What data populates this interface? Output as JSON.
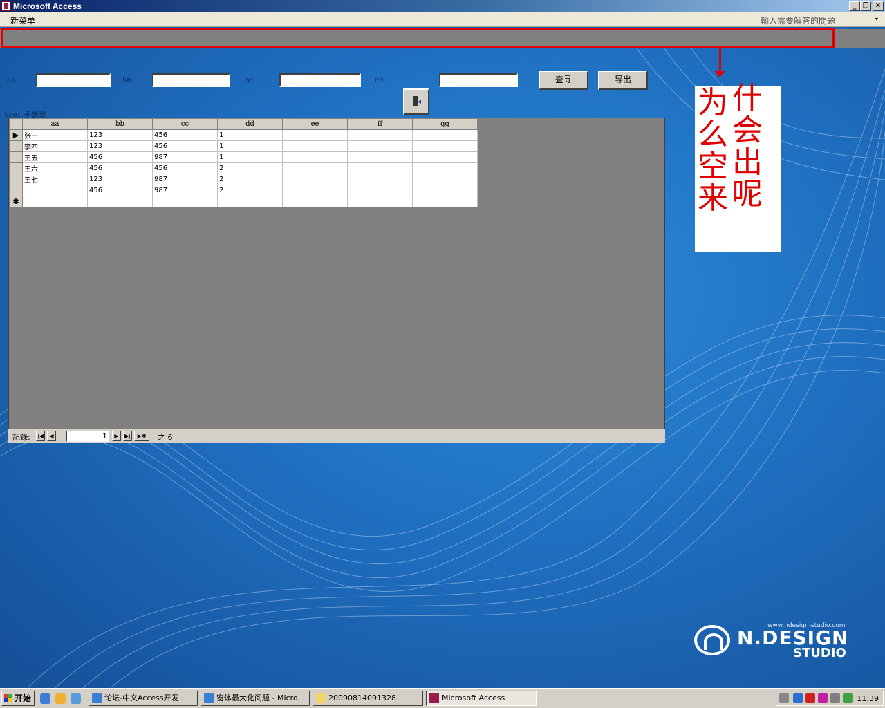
{
  "window": {
    "title": "Microsoft Access"
  },
  "window_buttons": {
    "minimize": "_",
    "restore": "❐",
    "close": "✕"
  },
  "menubar": {
    "menu_item": "新菜单",
    "help_placeholder": "輸入需要解答的問題",
    "help_arrow": "▾"
  },
  "filters": {
    "aa_label": "aa:",
    "bb_label": "bb:",
    "cc_label": "cc:",
    "dd_label": "dd",
    "aa_value": "",
    "bb_value": "",
    "cc_value": "",
    "dd_value": ""
  },
  "buttons": {
    "search": "查寻",
    "export": "导出"
  },
  "annotation": {
    "col1": "为么空来",
    "col2": "什会出呢"
  },
  "subform": {
    "label_en": "user",
    "label_zh": " 子表單"
  },
  "table": {
    "columns": [
      "aa",
      "bb",
      "cc",
      "dd",
      "ee",
      "ff",
      "gg"
    ],
    "rows": [
      [
        "张三",
        "123",
        "456",
        "1",
        "",
        "",
        ""
      ],
      [
        "李四",
        "123",
        "456",
        "1",
        "",
        "",
        ""
      ],
      [
        "王五",
        "456",
        "987",
        "1",
        "",
        "",
        ""
      ],
      [
        "王六",
        "456",
        "456",
        "2",
        "",
        "",
        ""
      ],
      [
        "王七",
        "123",
        "987",
        "2",
        "",
        "",
        ""
      ],
      [
        "",
        "456",
        "987",
        "2",
        "",
        "",
        ""
      ]
    ],
    "current_row_marker": "▶",
    "new_row_marker": "✱"
  },
  "navigation": {
    "label": "記錄:",
    "first": "|◀",
    "prev": "◀",
    "next": "▶",
    "last": "▶|",
    "new": "▶✱",
    "current_record": "1",
    "of_text": "之 6"
  },
  "branding": {
    "url": "www.ndesign-studio.com",
    "name": "N.DESIGN",
    "studio": "STUDIO"
  },
  "taskbar": {
    "start": "开始",
    "tasks": [
      {
        "label": "论坛-中文Access开发...",
        "icon": "ie-icon"
      },
      {
        "label": "窗体最大化问题 - Micro...",
        "icon": "ie-icon"
      },
      {
        "label": "20090814091328",
        "icon": "folder-icon"
      },
      {
        "label": "Microsoft Access",
        "icon": "access-icon"
      }
    ],
    "clock": "11:39"
  },
  "colors": {
    "annotation_red": "#e00000",
    "titlebar_blue": "#0a246a"
  }
}
